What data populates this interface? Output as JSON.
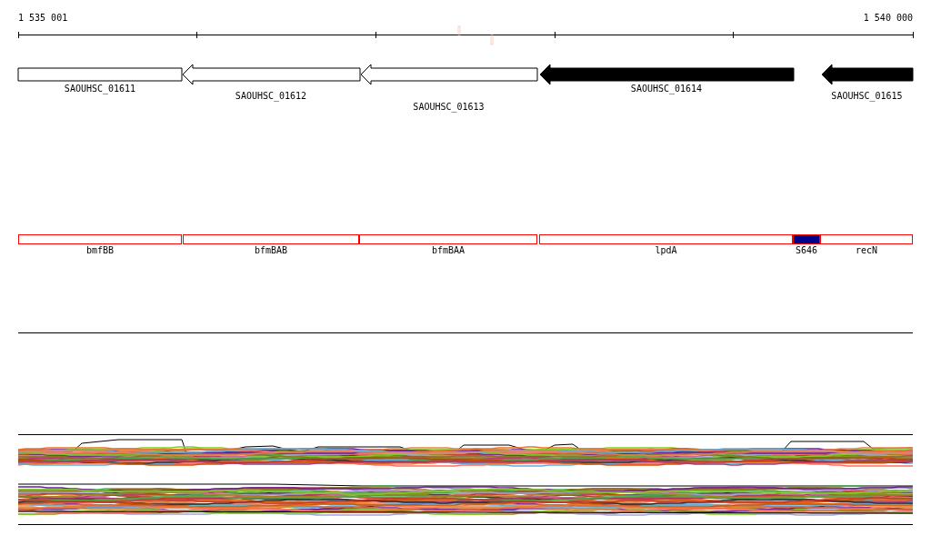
{
  "ruler": {
    "start_label": "1 535 001",
    "end_label": "1 540 000"
  },
  "genes": [
    {
      "label": "SAOUHSC_01611",
      "filled": false,
      "arrowhead": false
    },
    {
      "label": "SAOUHSC_01612",
      "filled": false,
      "arrowhead": true
    },
    {
      "label": "SAOUHSC_01613",
      "filled": false,
      "arrowhead": true
    },
    {
      "label": "SAOUHSC_01614",
      "filled": true,
      "arrowhead": true
    },
    {
      "label": "SAOUHSC_01615",
      "filled": true,
      "arrowhead": true
    }
  ],
  "features": [
    {
      "label": "bmfBB",
      "selected": false
    },
    {
      "label": "bfmBAB",
      "selected": false
    },
    {
      "label": "bfmBAA",
      "selected": false
    },
    {
      "label": "lpdA",
      "selected": false
    },
    {
      "label": "S646",
      "selected": true
    },
    {
      "label": "recN",
      "selected": false
    }
  ]
}
